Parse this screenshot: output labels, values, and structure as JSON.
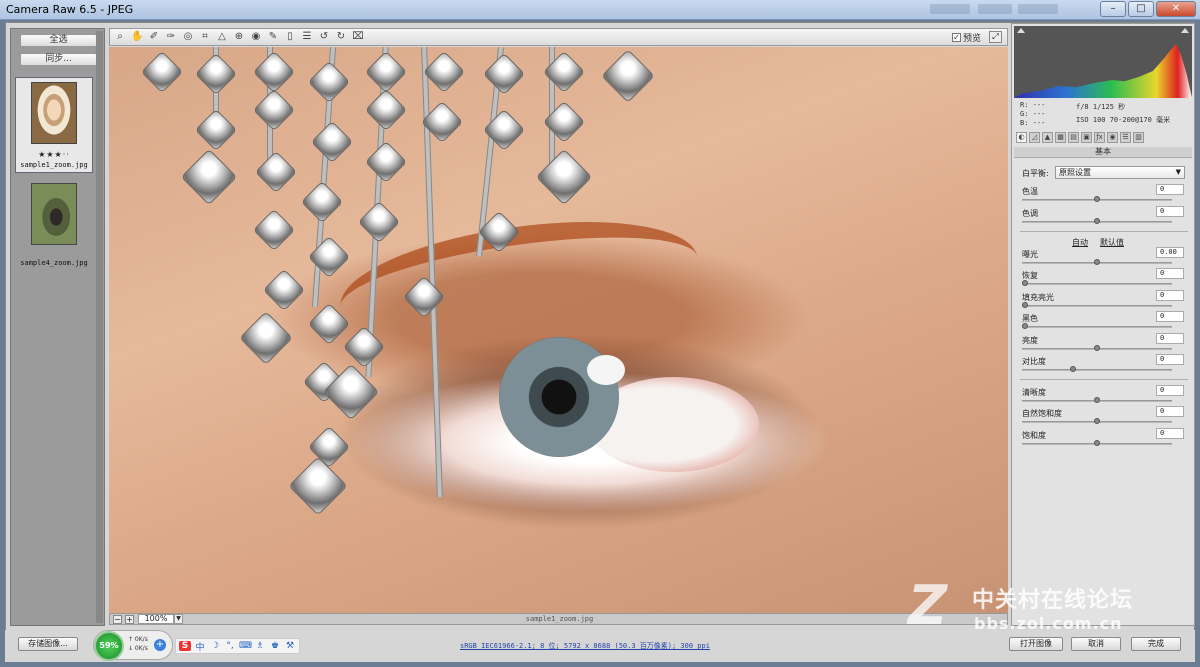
{
  "window": {
    "title": "Camera Raw 6.5 - JPEG",
    "minimize_label": "–",
    "maximize_label": "□",
    "close_label": "✕"
  },
  "filmstrip": {
    "select_all_label": "全选",
    "sync_label": "同步...",
    "items": [
      {
        "name": "sample1_zoom.jpg",
        "rating": "★★★··",
        "selected": true
      },
      {
        "name": "sample4_zoom.jpg",
        "selected": false
      }
    ]
  },
  "toolbar": {
    "tools": [
      {
        "name": "zoom-tool",
        "glyph": "⌕"
      },
      {
        "name": "hand-tool",
        "glyph": "✋"
      },
      {
        "name": "white-balance-tool",
        "glyph": "✐"
      },
      {
        "name": "color-sampler-tool",
        "glyph": "✑"
      },
      {
        "name": "targeted-adjustment-tool",
        "glyph": "◎"
      },
      {
        "name": "crop-tool",
        "glyph": "⌗"
      },
      {
        "name": "straighten-tool",
        "glyph": "△"
      },
      {
        "name": "spot-removal-tool",
        "glyph": "⊕"
      },
      {
        "name": "red-eye-tool",
        "glyph": "◉"
      },
      {
        "name": "adjustment-brush-tool",
        "glyph": "✎"
      },
      {
        "name": "graduated-filter-tool",
        "glyph": "▯"
      },
      {
        "name": "preferences-tool",
        "glyph": "☰"
      },
      {
        "name": "rotate-left-tool",
        "glyph": "↺"
      },
      {
        "name": "rotate-right-tool",
        "glyph": "↻"
      },
      {
        "name": "trash-tool",
        "glyph": "⌧"
      }
    ],
    "preview_label": "预览",
    "preview_checked": "✓"
  },
  "image_status": {
    "zoom_out": "−",
    "zoom_in": "+",
    "zoom_value": "100%",
    "zoom_arrow": "▼",
    "filename": "sample1_zoom.jpg"
  },
  "panel": {
    "readout": {
      "r": "R:  ---",
      "g": "G:  ---",
      "b": "B:  ---",
      "exif_line1": "f/8   1/125 秒",
      "exif_line2": "ISO 100   70-200@170 毫米"
    },
    "section_title": "基本",
    "white_balance_label": "白平衡:",
    "white_balance_value": "原照设置",
    "auto_label": "自动",
    "default_label": "默认值",
    "sliders": [
      {
        "key": "temperature",
        "label": "色温",
        "value": "0",
        "position": 0.5
      },
      {
        "key": "tint",
        "label": "色调",
        "value": "0",
        "position": 0.5
      },
      {
        "key": "exposure",
        "label": "曝光",
        "value": "0.00",
        "position": 0.5
      },
      {
        "key": "recovery",
        "label": "恢复",
        "value": "0",
        "position": 0.0
      },
      {
        "key": "fill-light",
        "label": "填充亮光",
        "value": "0",
        "position": 0.0
      },
      {
        "key": "blacks",
        "label": "黑色",
        "value": "0",
        "position": 0.0
      },
      {
        "key": "brightness",
        "label": "亮度",
        "value": "0",
        "position": 0.5
      },
      {
        "key": "contrast",
        "label": "对比度",
        "value": "0",
        "position": 0.33
      },
      {
        "key": "clarity",
        "label": "清晰度",
        "value": "0",
        "position": 0.5
      },
      {
        "key": "vibrance",
        "label": "自然饱和度",
        "value": "0",
        "position": 0.5
      },
      {
        "key": "saturation",
        "label": "饱和度",
        "value": "0",
        "position": 0.5
      }
    ]
  },
  "bottom": {
    "save_label": "存储图像...",
    "info_link": "sRGB IEC61966-2.1; 8 位; 5792 x 8688 (50.3 百万像素); 300 ppi",
    "open_label": "打开图像",
    "cancel_label": "取消",
    "done_label": "完成",
    "net_percent": "59%",
    "net_up": "↑  0K/s",
    "net_down": "↓  0K/s",
    "net_plus": "+",
    "ime": [
      "S",
      "中",
      "☽",
      "°,",
      "⌨",
      "♗",
      "♚",
      "⚒"
    ]
  },
  "watermark": {
    "logo_letter": "Z",
    "site_name": "中关村在线论坛",
    "url": "bbs.zol.com.cn"
  },
  "colors": {
    "accent_green": "#1d8a28",
    "link_blue": "#2244aa"
  }
}
